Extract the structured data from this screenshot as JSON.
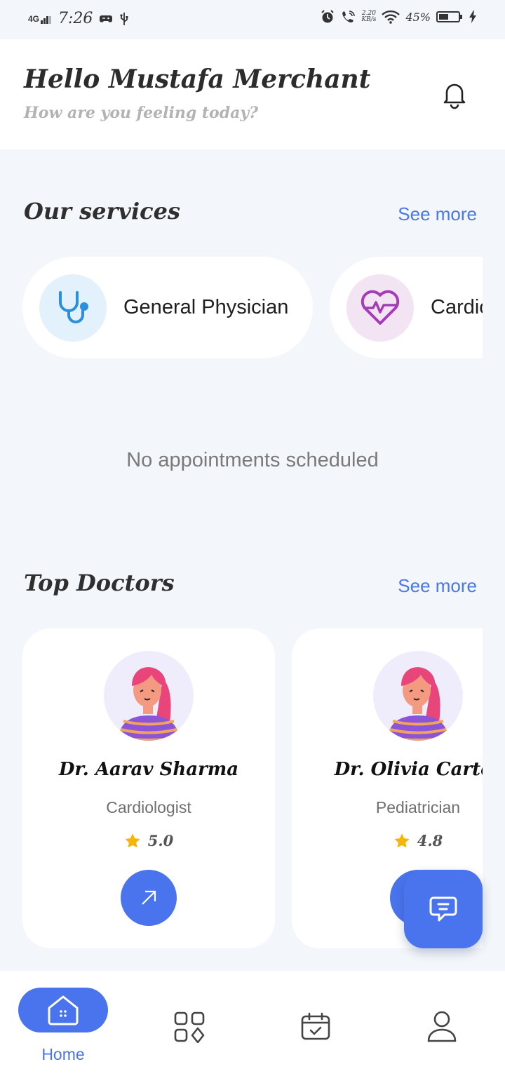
{
  "status_bar": {
    "network": "4G",
    "time": "7:26",
    "speed_value": "2.20",
    "speed_unit": "KB/s",
    "battery": "45%"
  },
  "header": {
    "greeting": "Hello Mustafa Merchant",
    "subtitle": "How are you feeling today?"
  },
  "services": {
    "title": "Our services",
    "see_more": "See more",
    "items": [
      {
        "label": "General Physician",
        "icon": "stethoscope-icon",
        "icon_bg": "#e3f1fc",
        "icon_color": "#2a8fdc"
      },
      {
        "label": "Cardiology",
        "icon": "heart-pulse-icon",
        "icon_bg": "#f3e4f4",
        "icon_color": "#a43bb7"
      }
    ]
  },
  "appointments": {
    "empty_text": "No appointments scheduled"
  },
  "doctors": {
    "title": "Top Doctors",
    "see_more": "See more",
    "items": [
      {
        "name": "Dr. Aarav Sharma",
        "specialty": "Cardiologist",
        "rating": "5.0"
      },
      {
        "name": "Dr. Olivia Carter",
        "specialty": "Pediatrician",
        "rating": "4.8"
      }
    ]
  },
  "nav": {
    "items": [
      {
        "label": "Home",
        "icon": "home-icon",
        "active": true
      },
      {
        "icon": "grid-icon",
        "active": false
      },
      {
        "icon": "calendar-icon",
        "active": false
      },
      {
        "icon": "profile-icon",
        "active": false
      }
    ]
  },
  "colors": {
    "accent": "#4a74ee",
    "background": "#f3f6fa",
    "star": "#f5b60b"
  }
}
